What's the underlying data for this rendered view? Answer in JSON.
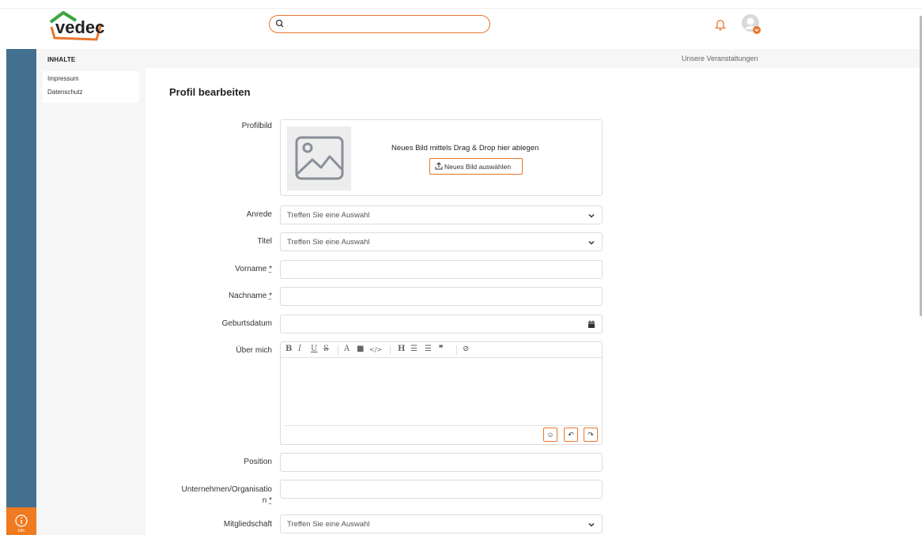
{
  "header": {
    "logo_text": "vedec",
    "search": {
      "placeholder": ""
    },
    "accent_color": "#e8762c"
  },
  "sidebar": {
    "heading": "INHALTE",
    "items": [
      {
        "label": "Impressum"
      },
      {
        "label": "Datenschutz"
      }
    ],
    "info_label": "Info"
  },
  "subheader": {
    "link": "Unsere Veranstaltungen"
  },
  "page": {
    "title": "Profil bearbeiten"
  },
  "form": {
    "profilbild": {
      "label": "Profilbild",
      "drop_text": "Neues Bild mittels Drag & Drop hier ablegen",
      "button": "Neues Bild auswählen"
    },
    "anrede": {
      "label": "Anrede",
      "value": "Treffen Sie eine Auswahl"
    },
    "titel": {
      "label": "Titel",
      "value": "Treffen Sie eine Auswahl"
    },
    "vorname": {
      "label": "Vorname",
      "required_mark": "*",
      "value": ""
    },
    "nachname": {
      "label": "Nachname",
      "required_mark": "*",
      "value": ""
    },
    "geburtsdatum": {
      "label": "Geburtsdatum",
      "value": ""
    },
    "ueber_mich": {
      "label": "Über mich",
      "toolbar": {
        "bold": "B",
        "italic": "I",
        "underline": "U",
        "strike": "S",
        "font_color": "A",
        "highlight": "■",
        "code": "</>",
        "heading": "H",
        "bullet_list": "☰",
        "ordered_list": "☰",
        "quote": "❞",
        "link": "⊘"
      },
      "buttons": {
        "emoji": "☺",
        "undo": "↶",
        "redo": "↷"
      }
    },
    "position": {
      "label": "Position",
      "value": ""
    },
    "unternehmen": {
      "label_line1": "Unternehmen/Organisatio",
      "label_line2": "n",
      "required_mark": "*",
      "value": ""
    },
    "mitgliedschaft": {
      "label": "Mitgliedschaft",
      "value": "Treffen Sie eine Auswahl"
    }
  }
}
